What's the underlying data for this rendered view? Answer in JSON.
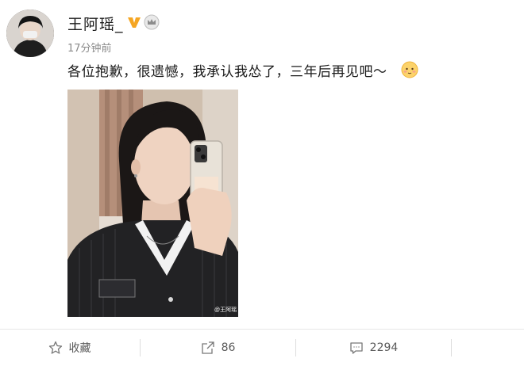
{
  "user": {
    "name": "王阿瑶_",
    "timestamp": "17分钟前",
    "avatar_icon": "avatar-icon",
    "verified_icon": "verified-v-icon",
    "crown_icon": "crown-icon",
    "verified_color": "#f5a623"
  },
  "post": {
    "text": "各位抱歉，很遗憾，我承认我怂了，三年后再见吧～",
    "emoji_icon": "blushing-face-icon",
    "photo_watermark": "@王阿瑶"
  },
  "actions": {
    "favorite_label": "收藏",
    "repost_count": "86",
    "comment_count": "2294"
  }
}
